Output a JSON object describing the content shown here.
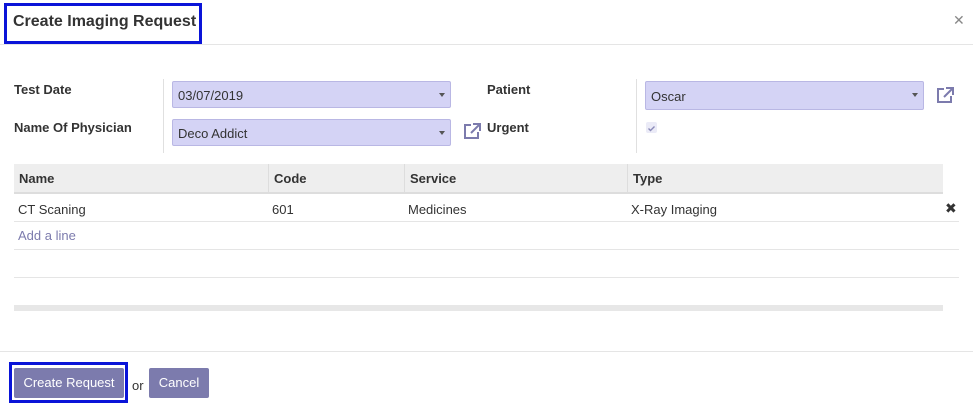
{
  "dialog": {
    "title": "Create Imaging Request",
    "close_icon": "close-icon"
  },
  "form": {
    "test_date": {
      "label": "Test Date",
      "value": "03/07/2019"
    },
    "physician": {
      "label": "Name Of Physician",
      "value": "Deco Addict",
      "link_icon": "external-link-icon"
    },
    "patient": {
      "label": "Patient",
      "value": "Oscar",
      "link_icon": "external-link-icon"
    },
    "urgent": {
      "label": "Urgent",
      "checked": true
    }
  },
  "table": {
    "columns": [
      "Name",
      "Code",
      "Service",
      "Type"
    ],
    "rows": [
      {
        "name": "CT Scaning",
        "code": "601",
        "service": "Medicines",
        "type": "X-Ray Imaging",
        "delete_icon": "trash-icon"
      }
    ],
    "add_line": "Add a line"
  },
  "footer": {
    "primary_label": "Create Request",
    "or_text": "or",
    "cancel_label": "Cancel"
  },
  "colors": {
    "accent": "#7c7bad",
    "highlight_border": "#0a14d8",
    "field_bg": "#d4d3f5"
  }
}
